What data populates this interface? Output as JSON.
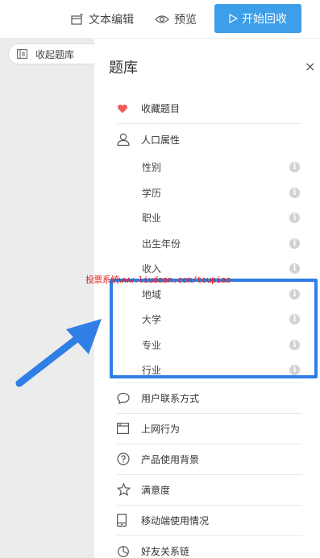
{
  "toolbar": {
    "text_edit_label": "文本编辑",
    "preview_label": "预览",
    "start_label": "开始回收"
  },
  "sidebar": {
    "collapse_label": "收起题库"
  },
  "panel": {
    "title": "题库",
    "close_label": "×",
    "favorites": "收藏题目",
    "population": {
      "label": "人口属性",
      "items": [
        "性别",
        "学历",
        "职业",
        "出生年份",
        "收入",
        "地域",
        "大学",
        "专业",
        "行业"
      ]
    },
    "sections": [
      "用户联系方式",
      "上网行为",
      "产品使用背景",
      "满意度",
      "移动端使用情况",
      "好友关系链"
    ]
  },
  "watermark": "投票系统www.liudaan.com/toupiao",
  "colors": {
    "accent": "#3d9eea",
    "highlight": "#2f7fe6",
    "heart": "#f0605a",
    "watermark": "#e02020"
  }
}
